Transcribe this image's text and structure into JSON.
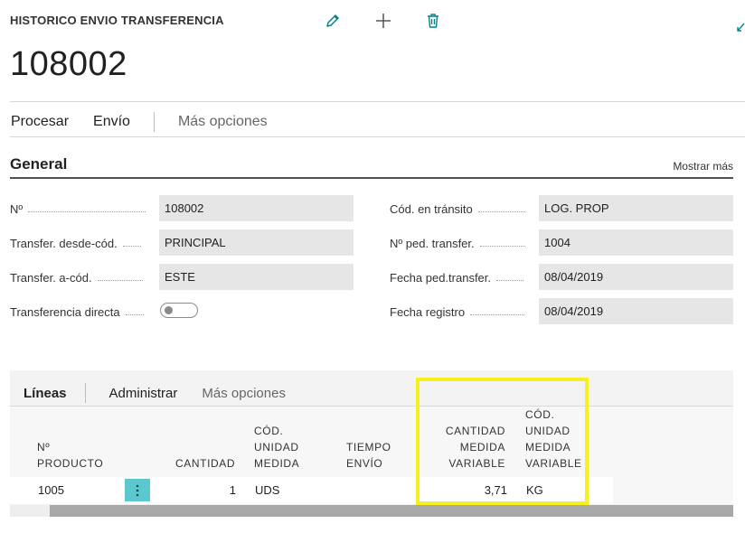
{
  "header": {
    "caption": "HISTORICO ENVIO TRANSFERENCIA",
    "record_number": "108002",
    "icons": [
      "edit-pencil-icon",
      "add-plus-icon",
      "delete-trash-icon",
      "collapse-arrow-icon"
    ]
  },
  "actions": {
    "procesar": "Procesar",
    "envio": "Envío",
    "mas_opciones": "Más opciones"
  },
  "general": {
    "title": "General",
    "show_more": "Mostrar más",
    "left_fields": [
      {
        "label": "Nº",
        "value": "108002"
      },
      {
        "label": "Transfer. desde-cód.",
        "value": "PRINCIPAL"
      },
      {
        "label": "Transfer. a-cód.",
        "value": "ESTE"
      },
      {
        "label": "Transferencia directa",
        "value": ""
      }
    ],
    "right_fields": [
      {
        "label": "Cód. en tránsito",
        "value": "LOG. PROP"
      },
      {
        "label": "Nº ped. transfer.",
        "value": "1004"
      },
      {
        "label": "Fecha ped.transfer.",
        "value": "08/04/2019"
      },
      {
        "label": "Fecha registro",
        "value": "08/04/2019"
      }
    ]
  },
  "lines": {
    "tabs": {
      "lineas": "Líneas",
      "administrar": "Administrar",
      "mas_opciones": "Más opciones"
    },
    "columns": {
      "producto": [
        "Nº",
        "PRODUCTO"
      ],
      "cantidad": [
        "CANTIDAD"
      ],
      "cod_unidad": [
        "CÓD.",
        "UNIDAD",
        "MEDIDA"
      ],
      "tiempo_envio": [
        "TIEMPO",
        "ENVÍO"
      ],
      "cantidad_variable": [
        "CANTIDAD",
        "MEDIDA",
        "VARIABLE"
      ],
      "cod_unidad_variable": [
        "CÓD.",
        "UNIDAD",
        "MEDIDA",
        "VARIABLE"
      ]
    },
    "rows": [
      {
        "producto": "1005",
        "cantidad": "1",
        "cod_unidad": "UDS",
        "tiempo_envio": "",
        "cantidad_variable": "3,71",
        "cod_unidad_variable": "KG"
      }
    ]
  },
  "colors": {
    "accent": "#008489",
    "highlight": "#f6f01e",
    "row_menu": "#5bc8cf",
    "field_bg": "#e6e6e6"
  }
}
